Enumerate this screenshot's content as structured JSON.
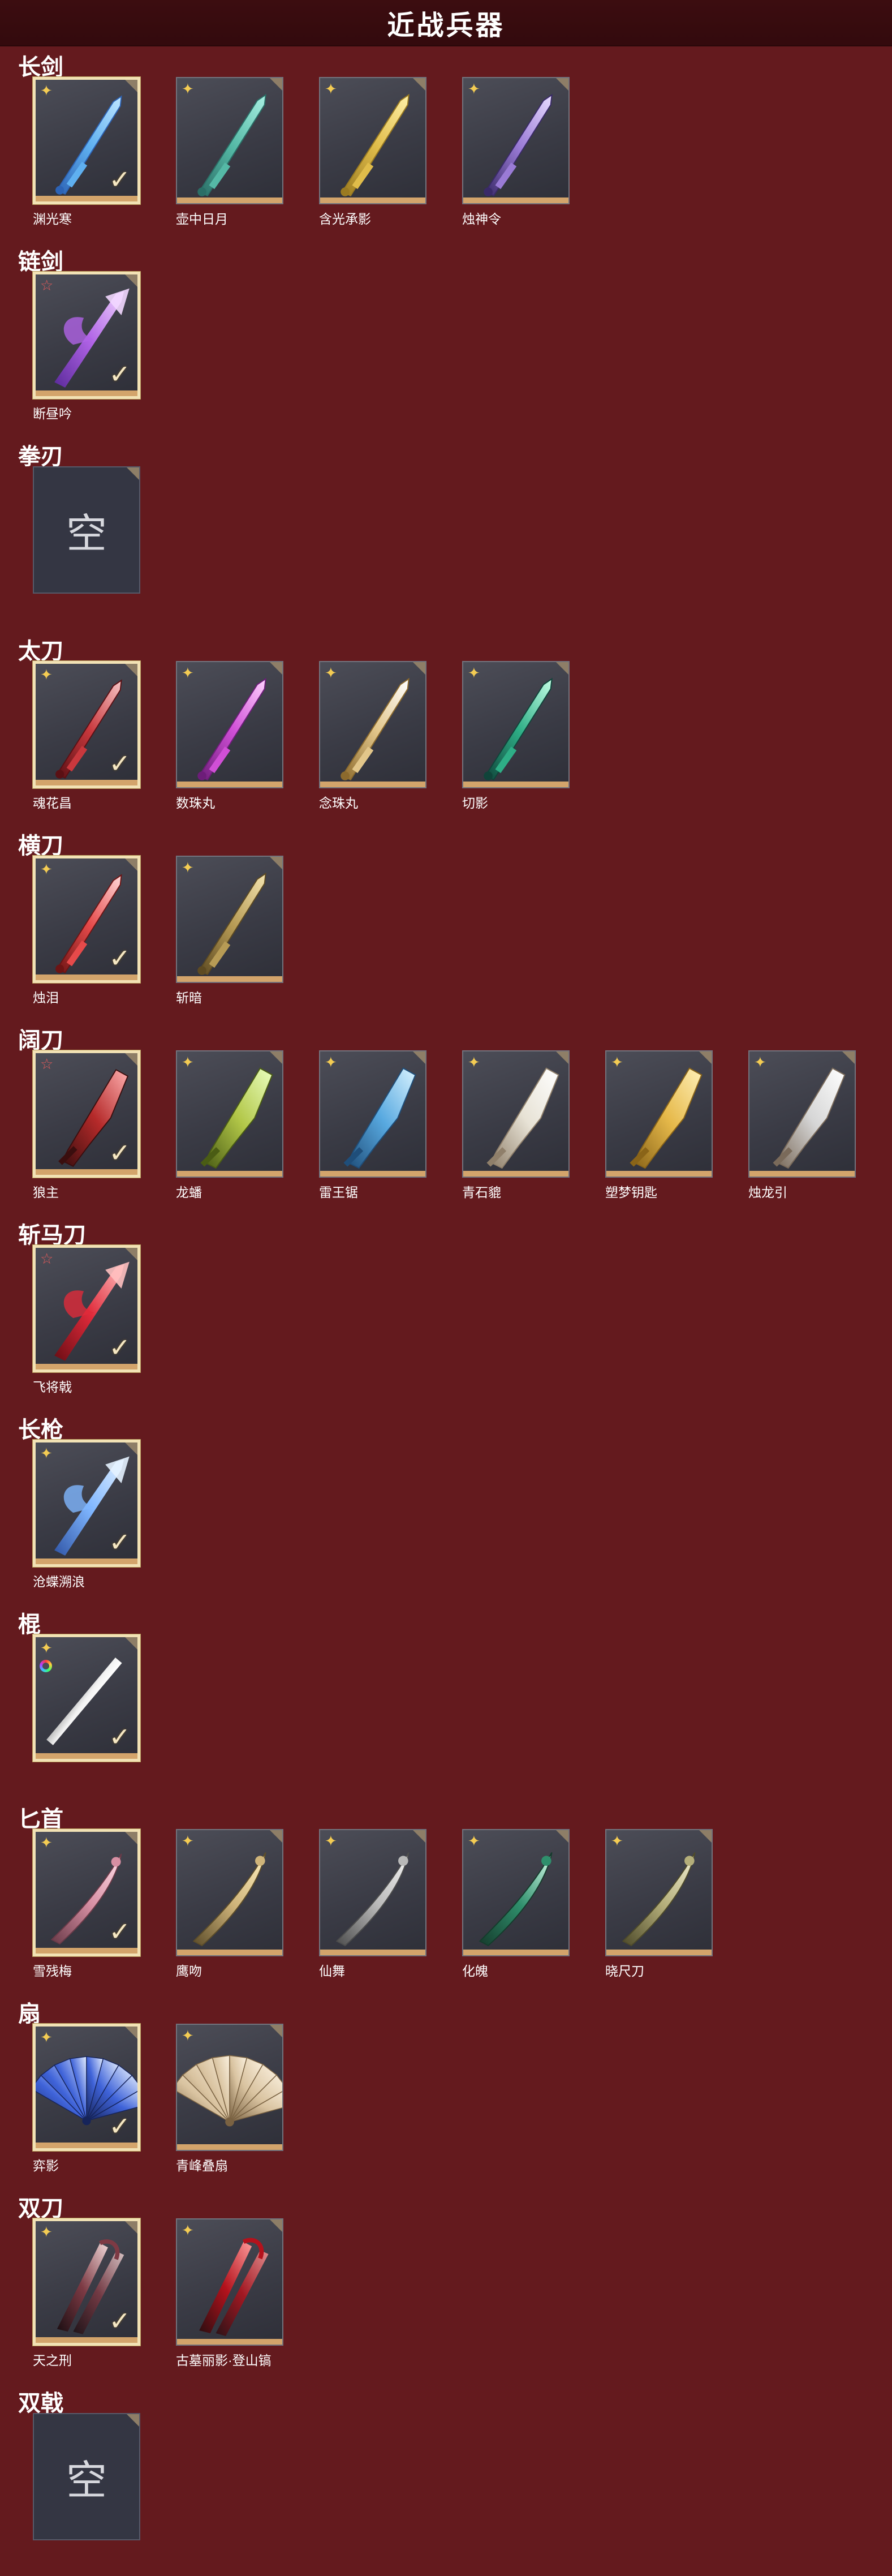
{
  "header": {
    "title": "近战兵器"
  },
  "empty_label": "空",
  "check_mark": "✓",
  "rarity_icons": {
    "gold": "✦",
    "red": "☆"
  },
  "colors": {
    "background": "#641a1e",
    "header_bg": "#3c0d10",
    "card_bg": "#3a3b45",
    "card_bar": "#d3a46b",
    "equipped_border": "#f2e2b5",
    "rarity_gold": "#f4cc53",
    "rarity_red": "#e05a5a"
  },
  "sections": [
    {
      "title": "长剑",
      "items": [
        {
          "name": "渊光寒",
          "rarity": "gold",
          "equipped": true,
          "art": "sword-ice"
        },
        {
          "name": "壶中日月",
          "rarity": "gold",
          "equipped": false,
          "art": "sword-teal"
        },
        {
          "name": "含光承影",
          "rarity": "gold",
          "equipped": false,
          "art": "sword-gold"
        },
        {
          "name": "烛神令",
          "rarity": "gold",
          "equipped": false,
          "art": "sword-violet"
        }
      ]
    },
    {
      "title": "链剑",
      "items": [
        {
          "name": "断昼吟",
          "rarity": "red",
          "equipped": true,
          "art": "chain-purple"
        }
      ]
    },
    {
      "title": "拳刃",
      "items": [
        {
          "name": "",
          "rarity": "",
          "equipped": false,
          "art": "empty",
          "empty": true
        }
      ]
    },
    {
      "title": "太刀",
      "items": [
        {
          "name": "魂花昌",
          "rarity": "gold",
          "equipped": true,
          "art": "katana-red"
        },
        {
          "name": "数珠丸",
          "rarity": "gold",
          "equipped": false,
          "art": "katana-pink"
        },
        {
          "name": "念珠丸",
          "rarity": "gold",
          "equipped": false,
          "art": "katana-white"
        },
        {
          "name": "切影",
          "rarity": "gold",
          "equipped": false,
          "art": "katana-green"
        }
      ]
    },
    {
      "title": "横刀",
      "items": [
        {
          "name": "烛泪",
          "rarity": "gold",
          "equipped": true,
          "art": "blade-red"
        },
        {
          "name": "斩暗",
          "rarity": "gold",
          "equipped": false,
          "art": "blade-bronze"
        }
      ]
    },
    {
      "title": "阔刀",
      "items": [
        {
          "name": "狼主",
          "rarity": "red",
          "equipped": true,
          "art": "broad-crimson"
        },
        {
          "name": "龙蟠",
          "rarity": "gold",
          "equipped": false,
          "art": "broad-green"
        },
        {
          "name": "雷王锯",
          "rarity": "gold",
          "equipped": false,
          "art": "broad-blue"
        },
        {
          "name": "青石貔",
          "rarity": "gold",
          "equipped": false,
          "art": "broad-white"
        },
        {
          "name": "塑梦钥匙",
          "rarity": "gold",
          "equipped": false,
          "art": "broad-gold"
        },
        {
          "name": "烛龙引",
          "rarity": "gold",
          "equipped": false,
          "art": "broad-silver"
        }
      ]
    },
    {
      "title": "斩马刀",
      "items": [
        {
          "name": "飞将戟",
          "rarity": "red",
          "equipped": true,
          "art": "zhanma-red"
        }
      ]
    },
    {
      "title": "长枪",
      "items": [
        {
          "name": "沧蝶溯浪",
          "rarity": "gold",
          "equipped": true,
          "art": "spear-blue"
        }
      ]
    },
    {
      "title": "棍",
      "items": [
        {
          "name": "",
          "rarity": "gold",
          "equipped": true,
          "art": "staff-white",
          "rainbow": true
        }
      ]
    },
    {
      "title": "匕首",
      "items": [
        {
          "name": "雪残梅",
          "rarity": "gold",
          "equipped": true,
          "art": "dagger-pink"
        },
        {
          "name": "鹰吻",
          "rarity": "gold",
          "equipped": false,
          "art": "dagger-gold"
        },
        {
          "name": "仙舞",
          "rarity": "gold",
          "equipped": false,
          "art": "dagger-silver"
        },
        {
          "name": "化魄",
          "rarity": "gold",
          "equipped": false,
          "art": "dagger-green"
        },
        {
          "name": "晓尺刀",
          "rarity": "gold",
          "equipped": false,
          "art": "dagger-olive"
        }
      ]
    },
    {
      "title": "扇",
      "items": [
        {
          "name": "弈影",
          "rarity": "gold",
          "equipped": true,
          "art": "fan-blue"
        },
        {
          "name": "青峰叠扇",
          "rarity": "gold",
          "equipped": false,
          "art": "fan-beige"
        }
      ]
    },
    {
      "title": "双刀",
      "items": [
        {
          "name": "天之刑",
          "rarity": "gold",
          "equipped": true,
          "art": "dual-dark"
        },
        {
          "name": "古墓丽影·登山镐",
          "rarity": "gold",
          "equipped": false,
          "art": "dual-red"
        }
      ]
    },
    {
      "title": "双戟",
      "items": [
        {
          "name": "",
          "rarity": "",
          "equipped": false,
          "art": "empty",
          "empty": true
        }
      ]
    }
  ]
}
